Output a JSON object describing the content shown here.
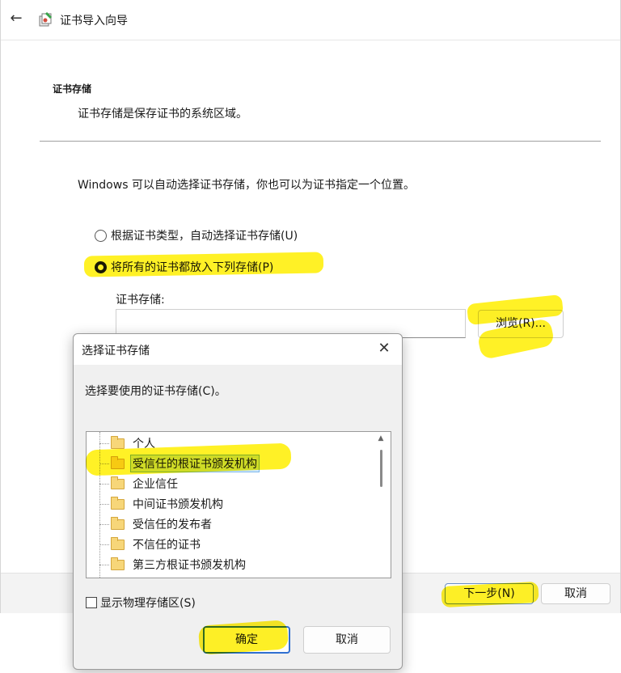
{
  "wizard": {
    "title": "证书导入向导",
    "section_heading": "证书存储",
    "section_description": "证书存储是保存证书的系统区域。",
    "intro": "Windows 可以自动选择证书存储，你也可以为证书指定一个位置。",
    "options": [
      {
        "label": "根据证书类型，自动选择证书存储(U)",
        "checked": false
      },
      {
        "label": "将所有的证书都放入下列存储(P)",
        "checked": true
      }
    ],
    "store_label": "证书存储:",
    "store_value": "",
    "browse_label": "浏览(R)...",
    "next_label": "下一步(N)",
    "cancel_label": "取消"
  },
  "dialog": {
    "title": "选择证书存储",
    "close_glyph": "✕",
    "prompt": "选择要使用的证书存储(C)。",
    "stores": [
      {
        "label": "个人",
        "selected": false
      },
      {
        "label": "受信任的根证书颁发机构",
        "selected": true
      },
      {
        "label": "企业信任",
        "selected": false
      },
      {
        "label": "中间证书颁发机构",
        "selected": false
      },
      {
        "label": "受信任的发布者",
        "selected": false
      },
      {
        "label": "不信任的证书",
        "selected": false
      },
      {
        "label": "第三方根证书颁发机构",
        "selected": false
      }
    ],
    "show_physical_label": "显示物理存储区(S)",
    "show_physical_checked": false,
    "ok_label": "确定",
    "cancel_label": "取消"
  },
  "colors": {
    "highlighter": "#ffee00",
    "selection": "#cfe8ff",
    "accent_border": "#2f6fd1"
  }
}
